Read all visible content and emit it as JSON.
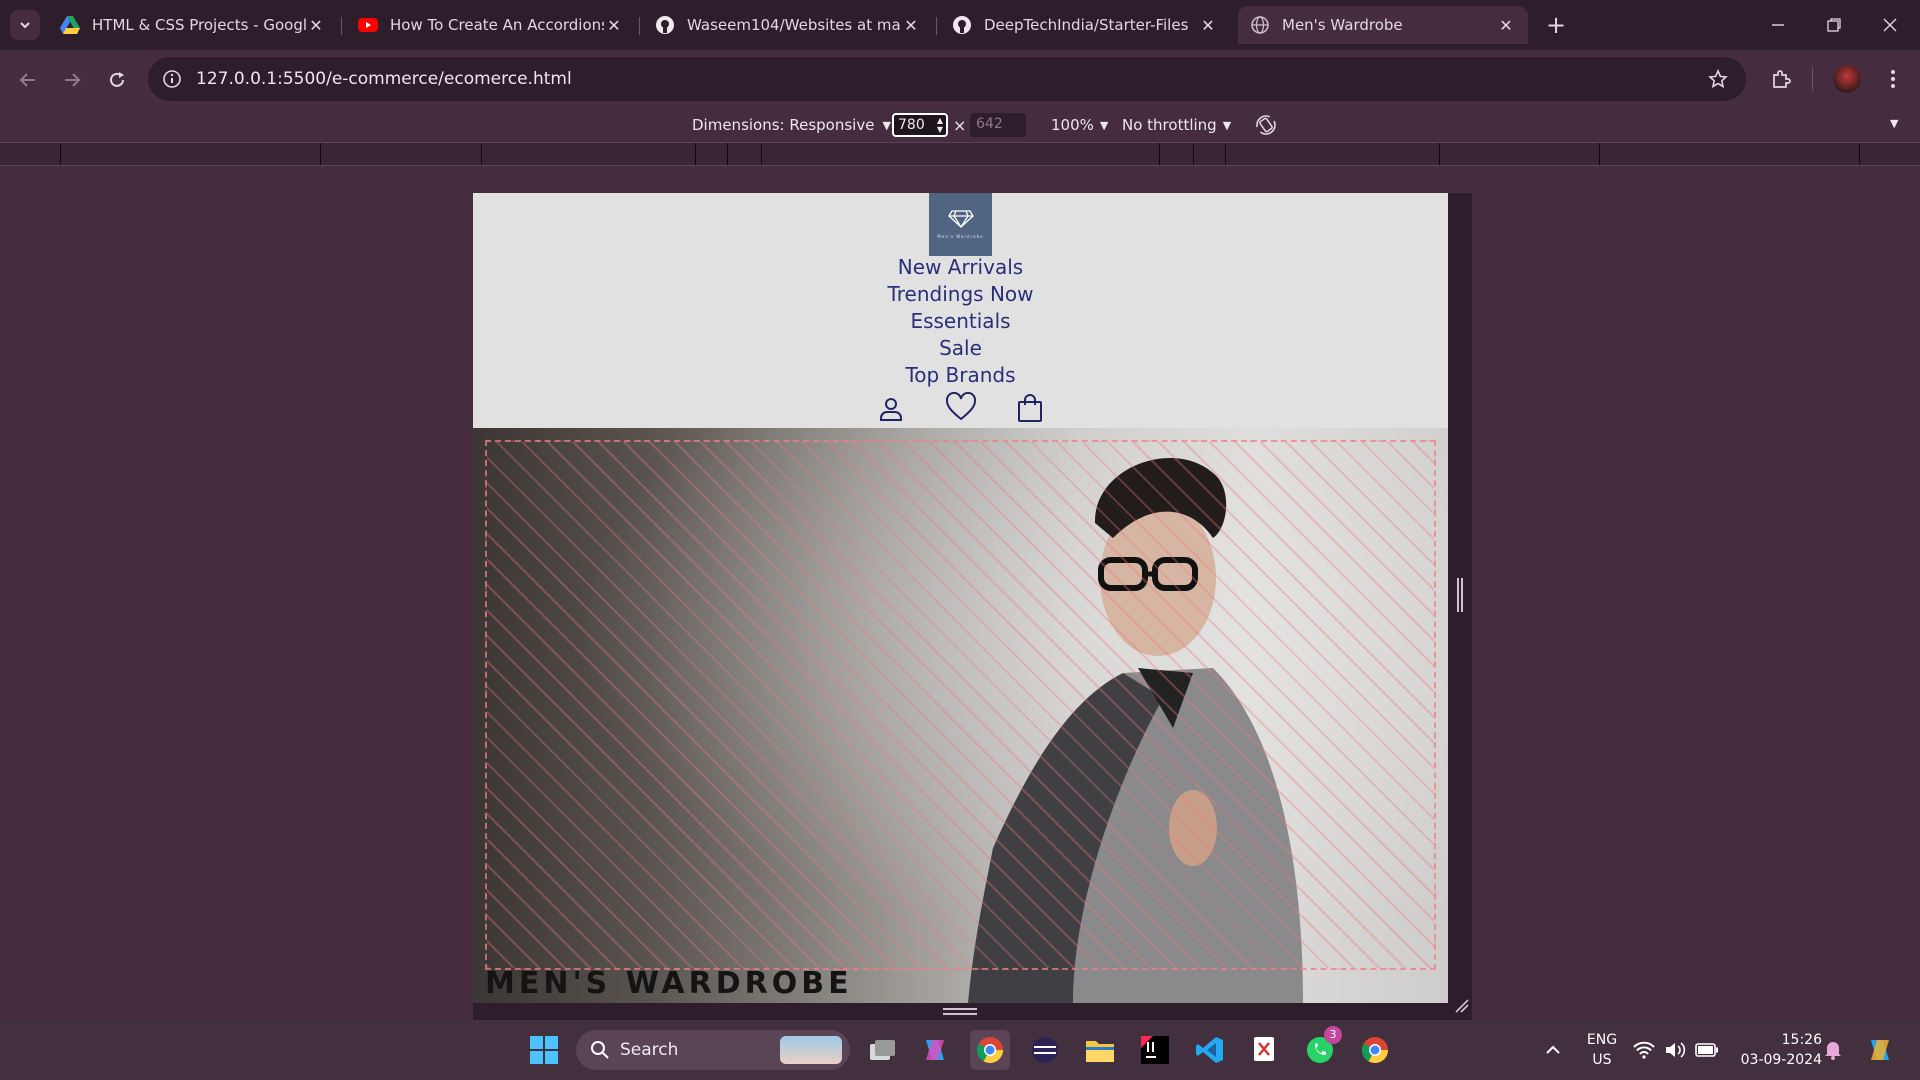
{
  "browser": {
    "tabs": [
      {
        "title": "HTML & CSS Projects - Google",
        "icon": "google-drive-icon"
      },
      {
        "title": "How To Create An Accordions In",
        "icon": "youtube-icon"
      },
      {
        "title": "Waseem104/Websites at master",
        "icon": "github-icon"
      },
      {
        "title": "DeepTechIndia/Starter-Files",
        "icon": "github-icon"
      },
      {
        "title": "Men's Wardrobe",
        "icon": "globe-icon",
        "active": true
      }
    ],
    "new_tab_label": "+",
    "url": "127.0.0.1:5500/e-commerce/ecomerce.html"
  },
  "devtools": {
    "dimensions_label": "Dimensions: Responsive",
    "width_value": "780",
    "times": "×",
    "height_placeholder": "642",
    "zoom_label": "100%",
    "throttle_label": "No throttling"
  },
  "site": {
    "logo_caption": "Men's Wardrobe",
    "nav": [
      {
        "label": "New Arrivals"
      },
      {
        "label": "Trendings Now"
      },
      {
        "label": "Essentials"
      },
      {
        "label": "Sale"
      },
      {
        "label": "Top Brands"
      }
    ],
    "hero_title": "MEN'S WARDROBE"
  },
  "taskbar": {
    "search_label": "Search",
    "lang_top": "ENG",
    "lang_bottom": "US",
    "time": "15:26",
    "date": "03-09-2024",
    "whatsapp_badge": "3"
  },
  "colors": {
    "frame": "#452d3f",
    "tabstrip": "#2e1d2a",
    "site_header_bg": "#e1e1e1",
    "nav_link": "#2a2f7a",
    "logo_bg": "#4f6582"
  }
}
